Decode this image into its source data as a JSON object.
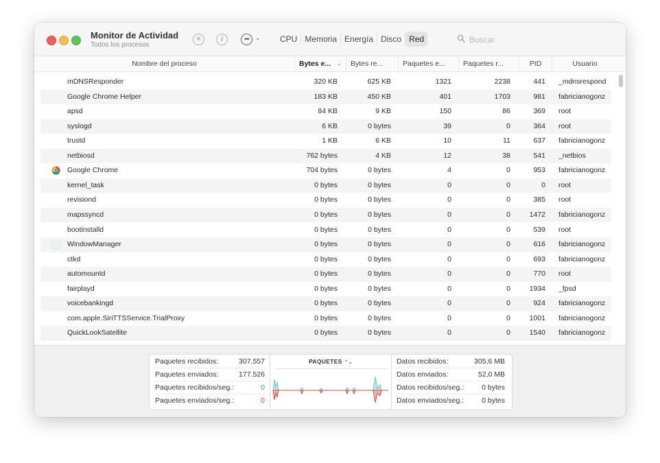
{
  "app": {
    "title": "Monitor de Actividad",
    "subtitle": "Todos los procesos"
  },
  "toolbar": {
    "tabs": [
      {
        "label": "CPU",
        "active": false
      },
      {
        "label": "Memoria",
        "active": false
      },
      {
        "label": "Energía",
        "active": false
      },
      {
        "label": "Disco",
        "active": false
      },
      {
        "label": "Red",
        "active": true
      }
    ],
    "search_placeholder": "Buscar",
    "search_value": "",
    "icons": [
      "stop-process-icon",
      "info-icon",
      "more-actions-icon",
      "chevron-down-icon",
      "search-icon"
    ]
  },
  "table": {
    "columns": [
      "Nombre del proceso",
      "Bytes e...",
      "Bytes re...",
      "Paquetes e...",
      "Paquetes r...",
      "PID",
      "Usuario"
    ],
    "sorted_column": "Bytes e...",
    "rows": [
      {
        "name": "mDNSResponder",
        "bytes_sent": "320 KB",
        "bytes_received": "625 KB",
        "packets_sent": "1321",
        "packets_received": "2238",
        "pid": "441",
        "user": "_mdnsrespond",
        "icon": "none"
      },
      {
        "name": "Google Chrome Helper",
        "bytes_sent": "183 KB",
        "bytes_received": "450 KB",
        "packets_sent": "401",
        "packets_received": "1703",
        "pid": "981",
        "user": "fabricianogonz",
        "icon": "none"
      },
      {
        "name": "apsd",
        "bytes_sent": "84 KB",
        "bytes_received": "9 KB",
        "packets_sent": "150",
        "packets_received": "86",
        "pid": "369",
        "user": "root",
        "icon": "none"
      },
      {
        "name": "syslogd",
        "bytes_sent": "6 KB",
        "bytes_received": "0 bytes",
        "packets_sent": "39",
        "packets_received": "0",
        "pid": "364",
        "user": "root",
        "icon": "none"
      },
      {
        "name": "trustd",
        "bytes_sent": "1 KB",
        "bytes_received": "6 KB",
        "packets_sent": "10",
        "packets_received": "11",
        "pid": "637",
        "user": "fabricianogonz",
        "icon": "none"
      },
      {
        "name": "netbiosd",
        "bytes_sent": "762 bytes",
        "bytes_received": "4 KB",
        "packets_sent": "12",
        "packets_received": "38",
        "pid": "541",
        "user": "_netbios",
        "icon": "none"
      },
      {
        "name": "Google Chrome",
        "bytes_sent": "704 bytes",
        "bytes_received": "0 bytes",
        "packets_sent": "4",
        "packets_received": "0",
        "pid": "953",
        "user": "fabricianogonz",
        "icon": "chrome-icon"
      },
      {
        "name": "kernel_task",
        "bytes_sent": "0 bytes",
        "bytes_received": "0 bytes",
        "packets_sent": "0",
        "packets_received": "0",
        "pid": "0",
        "user": "root",
        "icon": "none"
      },
      {
        "name": "revisiond",
        "bytes_sent": "0 bytes",
        "bytes_received": "0 bytes",
        "packets_sent": "0",
        "packets_received": "0",
        "pid": "385",
        "user": "root",
        "icon": "none"
      },
      {
        "name": "mapssyncd",
        "bytes_sent": "0 bytes",
        "bytes_received": "0 bytes",
        "packets_sent": "0",
        "packets_received": "0",
        "pid": "1472",
        "user": "fabricianogonz",
        "icon": "none"
      },
      {
        "name": "bootinstalld",
        "bytes_sent": "0 bytes",
        "bytes_received": "0 bytes",
        "packets_sent": "0",
        "packets_received": "0",
        "pid": "539",
        "user": "root",
        "icon": "none"
      },
      {
        "name": "WindowManager",
        "bytes_sent": "0 bytes",
        "bytes_received": "0 bytes",
        "packets_sent": "0",
        "packets_received": "0",
        "pid": "616",
        "user": "fabricianogonz",
        "icon": "window-manager-icon"
      },
      {
        "name": "ctkd",
        "bytes_sent": "0 bytes",
        "bytes_received": "0 bytes",
        "packets_sent": "0",
        "packets_received": "0",
        "pid": "693",
        "user": "fabricianogonz",
        "icon": "none"
      },
      {
        "name": "automountd",
        "bytes_sent": "0 bytes",
        "bytes_received": "0 bytes",
        "packets_sent": "0",
        "packets_received": "0",
        "pid": "770",
        "user": "root",
        "icon": "none"
      },
      {
        "name": "fairplayd",
        "bytes_sent": "0 bytes",
        "bytes_received": "0 bytes",
        "packets_sent": "0",
        "packets_received": "0",
        "pid": "1934",
        "user": "_fpsd",
        "icon": "none"
      },
      {
        "name": "voicebankingd",
        "bytes_sent": "0 bytes",
        "bytes_received": "0 bytes",
        "packets_sent": "0",
        "packets_received": "0",
        "pid": "924",
        "user": "fabricianogonz",
        "icon": "none"
      },
      {
        "name": "com.apple.SiriTTSService.TrialProxy",
        "bytes_sent": "0 bytes",
        "bytes_received": "0 bytes",
        "packets_sent": "0",
        "packets_received": "0",
        "pid": "1001",
        "user": "fabricianogonz",
        "icon": "none"
      },
      {
        "name": "QuickLookSatellite",
        "bytes_sent": "0 bytes",
        "bytes_received": "0 bytes",
        "packets_sent": "0",
        "packets_received": "0",
        "pid": "1540",
        "user": "fabricianogonz",
        "icon": "none"
      }
    ]
  },
  "stats": {
    "left": [
      {
        "label": "Paquetes recibidos:",
        "value": "307.557",
        "color": "default"
      },
      {
        "label": "Paquetes enviados:",
        "value": "177.526",
        "color": "default"
      },
      {
        "label": "Paquetes recibidos/seg.:",
        "value": "0",
        "color": "blue"
      },
      {
        "label": "Paquetes enviados/seg.:",
        "value": "0",
        "color": "red"
      }
    ],
    "graph_title": "PAQUETES",
    "right": [
      {
        "label": "Datos recibidos:",
        "value": "305,6 MB"
      },
      {
        "label": "Datos enviados:",
        "value": "52,0 MB"
      },
      {
        "label": "Datos recibidos/seg.:",
        "value": "0 bytes"
      },
      {
        "label": "Datos enviados/seg.:",
        "value": "0 bytes"
      }
    ]
  },
  "colors": {
    "received": "#7fd0dc",
    "sent": "#e0746a",
    "active_tab": "#e4e4e4",
    "row_alt": "#f4f4f4"
  }
}
